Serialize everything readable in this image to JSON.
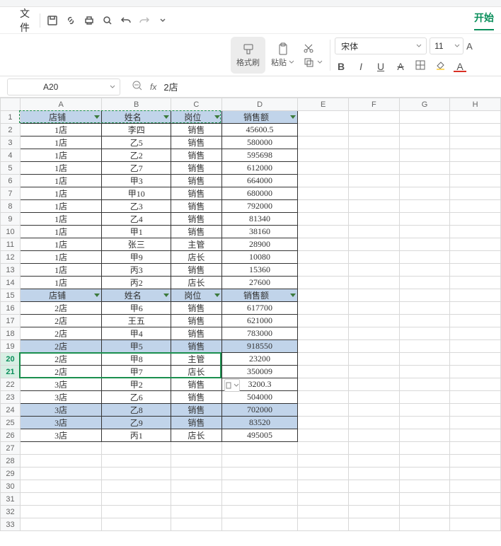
{
  "menu": {
    "file": "文件",
    "tab_start": "开始"
  },
  "ribbon": {
    "format_painter": "格式刷",
    "paste": "粘贴",
    "font_name": "宋体",
    "font_size": "11"
  },
  "namebox": "A20",
  "formula": "2店",
  "columns": [
    "A",
    "B",
    "C",
    "D",
    "E",
    "F",
    "G",
    "H"
  ],
  "headers": {
    "A": "店铺",
    "B": "姓名",
    "C": "岗位",
    "D": "销售额"
  },
  "rows": [
    {
      "r": 1,
      "blue": true,
      "hdr": true,
      "A": "店铺",
      "B": "姓名",
      "C": "岗位",
      "D": "销售额"
    },
    {
      "r": 2,
      "A": "1店",
      "B": "李四",
      "C": "销售",
      "D": "45600.5"
    },
    {
      "r": 3,
      "A": "1店",
      "B": "乙5",
      "C": "销售",
      "D": "580000"
    },
    {
      "r": 4,
      "A": "1店",
      "B": "乙2",
      "C": "销售",
      "D": "595698"
    },
    {
      "r": 5,
      "A": "1店",
      "B": "乙7",
      "C": "销售",
      "D": "612000"
    },
    {
      "r": 6,
      "A": "1店",
      "B": "甲3",
      "C": "销售",
      "D": "664000"
    },
    {
      "r": 7,
      "A": "1店",
      "B": "甲10",
      "C": "销售",
      "D": "680000"
    },
    {
      "r": 8,
      "A": "1店",
      "B": "乙3",
      "C": "销售",
      "D": "792000"
    },
    {
      "r": 9,
      "A": "1店",
      "B": "乙4",
      "C": "销售",
      "D": "81340"
    },
    {
      "r": 10,
      "A": "1店",
      "B": "甲1",
      "C": "销售",
      "D": "38160"
    },
    {
      "r": 11,
      "A": "1店",
      "B": "张三",
      "C": "主管",
      "D": "28900"
    },
    {
      "r": 12,
      "A": "1店",
      "B": "甲9",
      "C": "店长",
      "D": "10080"
    },
    {
      "r": 13,
      "A": "1店",
      "B": "丙3",
      "C": "销售",
      "D": "15360"
    },
    {
      "r": 14,
      "A": "1店",
      "B": "丙2",
      "C": "店长",
      "D": "27600"
    },
    {
      "r": 15,
      "blue": true,
      "hdr": true,
      "A": "店铺",
      "B": "姓名",
      "C": "岗位",
      "D": "销售额"
    },
    {
      "r": 16,
      "A": "2店",
      "B": "甲6",
      "C": "销售",
      "D": "617700"
    },
    {
      "r": 17,
      "A": "2店",
      "B": "王五",
      "C": "销售",
      "D": "621000"
    },
    {
      "r": 18,
      "A": "2店",
      "B": "甲4",
      "C": "销售",
      "D": "783000"
    },
    {
      "r": 19,
      "blue": true,
      "A": "2店",
      "B": "甲5",
      "C": "销售",
      "D": "918550"
    },
    {
      "r": 20,
      "active": true,
      "A": "2店",
      "B": "甲8",
      "C": "主管",
      "D": "23200"
    },
    {
      "r": 21,
      "active": true,
      "A": "2店",
      "B": "甲7",
      "C": "店长",
      "D": "350009"
    },
    {
      "r": 22,
      "A": "3店",
      "B": "甲2",
      "C": "销售",
      "D": "3200.3"
    },
    {
      "r": 23,
      "A": "3店",
      "B": "乙6",
      "C": "销售",
      "D": "504000"
    },
    {
      "r": 24,
      "blue": true,
      "A": "3店",
      "B": "乙8",
      "C": "销售",
      "D": "702000"
    },
    {
      "r": 25,
      "blue": true,
      "A": "3店",
      "B": "乙9",
      "C": "销售",
      "D": "83520"
    },
    {
      "r": 26,
      "A": "3店",
      "B": "丙1",
      "C": "店长",
      "D": "495005"
    }
  ],
  "empty_rows": [
    27,
    28,
    29,
    30,
    31,
    32,
    33
  ]
}
